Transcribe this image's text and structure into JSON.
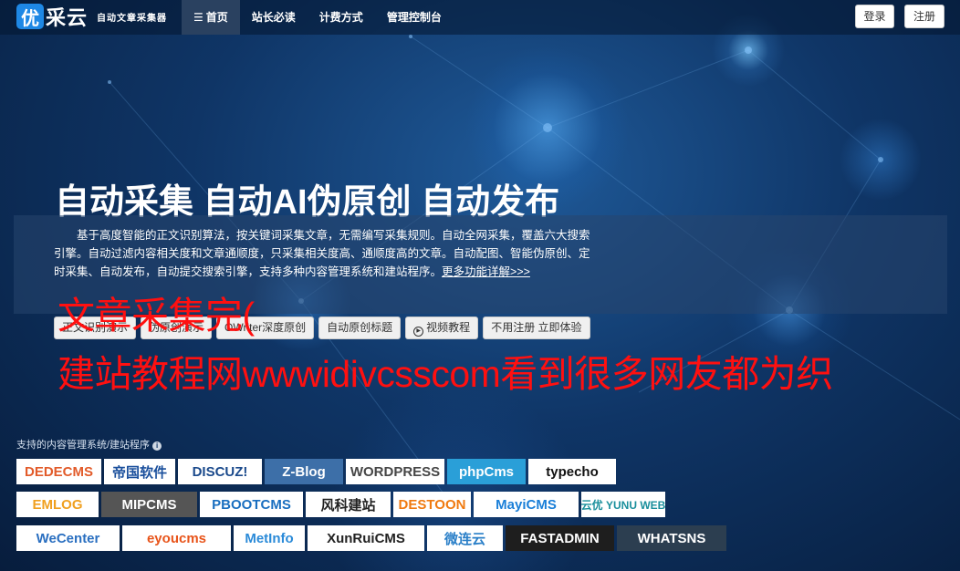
{
  "header": {
    "logo_mark": "优",
    "logo_name": "采云",
    "logo_sub": "自动文章采集器",
    "nav": [
      {
        "label": "首页",
        "active": true
      },
      {
        "label": "站长必读"
      },
      {
        "label": "计费方式"
      },
      {
        "label": "管理控制台"
      }
    ],
    "login_label": "登录",
    "register_label": "注册"
  },
  "hero": {
    "headline": "自动采集 自动AI伪原创 自动发布",
    "description": "基于高度智能的正文识别算法，按关键词采集文章，无需编写采集规则。自动全网采集，覆盖六大搜索引擎。自动过滤内容相关度和文章通顺度，只采集相关度高、通顺度高的文章。自动配图、智能伪原创、定时采集、自动发布，自动提交搜索引擎，支持多种内容管理系统和建站程序。",
    "more_link": "更多功能详解>>>",
    "buttons": [
      "正文识别演示",
      "伪原创演示",
      "OWriter深度原创",
      "自动原创标题",
      "视频教程",
      "不用注册 立即体验"
    ]
  },
  "overlay": {
    "line1": "文章采集完(",
    "line2": "建站教程网wwwidivcsscom看到很多网友都为织"
  },
  "cms": {
    "title": "支持的内容管理系统/建站程序",
    "rows": [
      [
        {
          "label": "DEDECMS",
          "width": 93,
          "bg": "#ffffff",
          "color": "#e25b2a"
        },
        {
          "label": "帝国软件",
          "width": 78,
          "bg": "#ffffff",
          "color": "#1a4f9c"
        },
        {
          "label": "DISCUZ!",
          "width": 92,
          "bg": "#ffffff",
          "color": "#1b4a8c"
        },
        {
          "label": "Z-Blog",
          "width": 86,
          "bg": "#3d6fa8",
          "color": "#ffffff"
        },
        {
          "label": "WORDPRESS",
          "width": 108,
          "bg": "#ffffff",
          "color": "#464646"
        },
        {
          "label": "phpCms",
          "width": 86,
          "bg": "#2a9fd8",
          "color": "#ffffff"
        },
        {
          "label": "typecho",
          "width": 96,
          "bg": "#ffffff",
          "color": "#111111"
        }
      ],
      [
        {
          "label": "EMLOG",
          "width": 90,
          "bg": "#ffffff",
          "color": "#f0a020"
        },
        {
          "label": "MIPCMS",
          "width": 105,
          "bg": "#555555",
          "color": "#ffffff"
        },
        {
          "label": "PBOOTCMS",
          "width": 113,
          "bg": "#ffffff",
          "color": "#1a6fc0"
        },
        {
          "label": "风科建站",
          "width": 93,
          "bg": "#ffffff",
          "color": "#222222"
        },
        {
          "label": "DESTOON",
          "width": 85,
          "bg": "#ffffff",
          "color": "#f07a10"
        },
        {
          "label": "MayiCMS",
          "width": 115,
          "bg": "#ffffff",
          "color": "#1a7fd8"
        },
        {
          "label": "云优 YUNU WEB",
          "width": 92,
          "bg": "#ffffff",
          "color": "#1a8f9c"
        }
      ],
      [
        {
          "label": "WeCenter",
          "width": 113,
          "bg": "#ffffff",
          "color": "#2a6fc0"
        },
        {
          "label": "eyoucms",
          "width": 119,
          "bg": "#ffffff",
          "color": "#e8541a"
        },
        {
          "label": "MetInfo",
          "width": 78,
          "bg": "#ffffff",
          "color": "#2a8ad8"
        },
        {
          "label": "XunRuiCMS",
          "width": 128,
          "bg": "#ffffff",
          "color": "#222222"
        },
        {
          "label": "微连云",
          "width": 83,
          "bg": "#ffffff",
          "color": "#2a7fc8"
        },
        {
          "label": "FASTADMIN",
          "width": 119,
          "bg": "#1e1e1e",
          "color": "#ffffff"
        },
        {
          "label": "WHATSNS",
          "width": 120,
          "bg": "#2c3e50",
          "color": "#ffffff"
        }
      ]
    ]
  }
}
